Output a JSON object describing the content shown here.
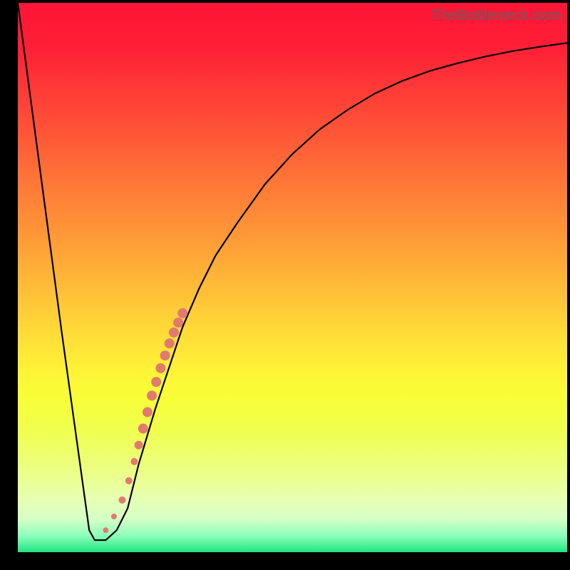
{
  "watermark": "TheBottleneck.com",
  "chart_data": {
    "type": "line",
    "title": "",
    "xlabel": "",
    "ylabel": "",
    "xlim": [
      0,
      100
    ],
    "ylim": [
      0,
      100
    ],
    "grid": false,
    "legend": false,
    "series": [
      {
        "name": "curve",
        "type": "line",
        "color": "#000000",
        "x": [
          0,
          2,
          4,
          6,
          8,
          10.5,
          13,
          14,
          16,
          18,
          20,
          22,
          25,
          28,
          30,
          33,
          36,
          40,
          45,
          50,
          55,
          60,
          65,
          70,
          75,
          80,
          85,
          90,
          95,
          100
        ],
        "y": [
          100,
          85,
          70,
          55,
          40,
          22,
          4,
          2.2,
          2.2,
          4,
          8,
          16,
          26,
          35,
          41,
          48,
          54,
          60,
          67,
          72.5,
          77,
          80.5,
          83.5,
          85.8,
          87.6,
          89,
          90.2,
          91.2,
          92,
          92.7
        ]
      },
      {
        "name": "highlight-band",
        "type": "scatter",
        "color": "#e27a6f",
        "x": [
          16.0,
          17.5,
          19.0,
          20.2,
          21.2,
          22.0,
          22.8,
          23.6,
          24.4,
          25.2,
          26.0,
          26.8,
          27.6,
          28.4,
          29.2,
          30.0
        ],
        "y": [
          4.0,
          6.5,
          9.5,
          13.0,
          16.5,
          19.5,
          22.5,
          25.5,
          28.5,
          31.0,
          33.5,
          35.8,
          38.0,
          40.0,
          41.8,
          43.5
        ],
        "size": [
          8,
          8,
          10,
          10,
          10,
          12,
          14,
          14,
          14,
          14,
          14,
          14,
          14,
          14,
          14,
          14
        ]
      }
    ]
  }
}
